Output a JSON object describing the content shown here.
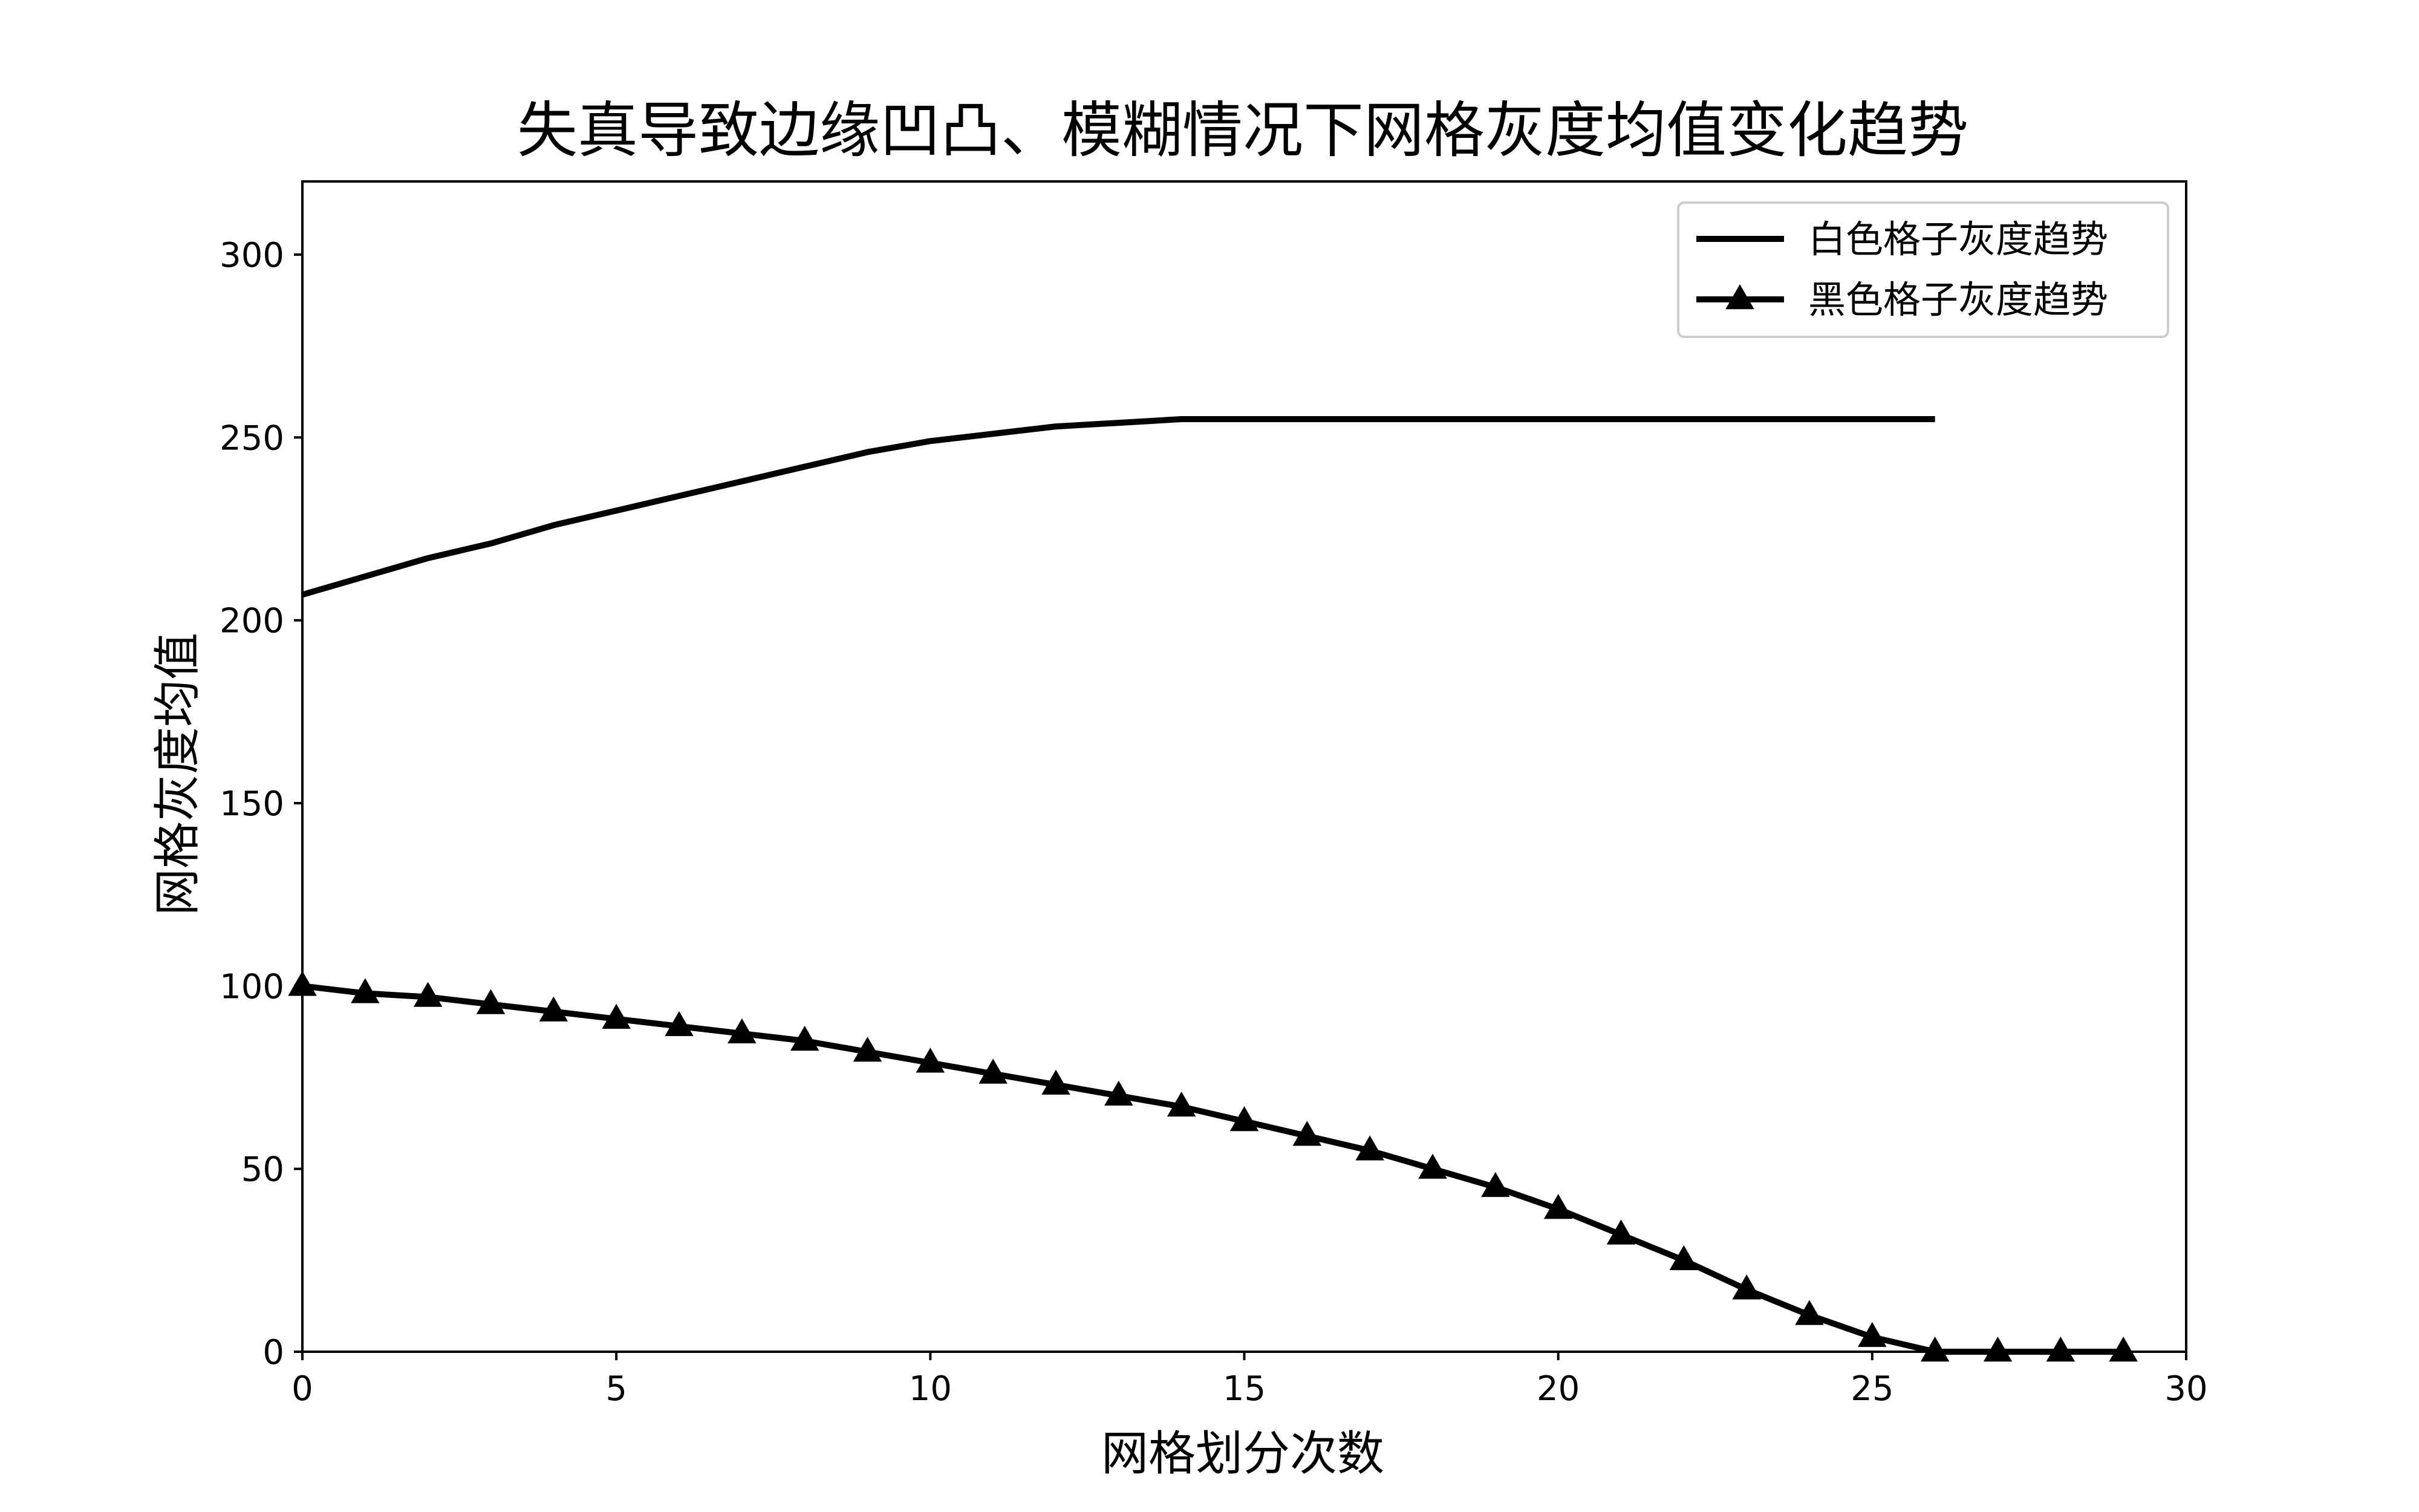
{
  "chart_data": {
    "type": "line",
    "title": "失真导致边缘凹凸、模糊情况下网格灰度均值变化趋势",
    "xlabel": "网格划分次数",
    "ylabel": "网格灰度均值",
    "xlim": [
      0,
      30
    ],
    "ylim": [
      0,
      320
    ],
    "xticks": [
      0,
      5,
      10,
      15,
      20,
      25,
      30
    ],
    "yticks": [
      0,
      50,
      100,
      150,
      200,
      250,
      300
    ],
    "grid": false,
    "legend_position": "top-right",
    "series": [
      {
        "name": "白色格子灰度趋势",
        "color": "#000000",
        "marker": "none",
        "x": [
          0,
          1,
          2,
          3,
          4,
          5,
          6,
          7,
          8,
          9,
          10,
          11,
          12,
          13,
          14,
          15,
          16,
          17,
          18,
          19,
          20,
          21,
          22,
          23,
          24,
          25,
          26
        ],
        "values": [
          207,
          212,
          217,
          221,
          226,
          230,
          234,
          238,
          242,
          246,
          249,
          251,
          253,
          254,
          255,
          255,
          255,
          255,
          255,
          255,
          255,
          255,
          255,
          255,
          255,
          255,
          255
        ]
      },
      {
        "name": "黑色格子灰度趋势",
        "color": "#000000",
        "marker": "triangle",
        "x": [
          0,
          1,
          2,
          3,
          4,
          5,
          6,
          7,
          8,
          9,
          10,
          11,
          12,
          13,
          14,
          15,
          16,
          17,
          18,
          19,
          20,
          21,
          22,
          23,
          24,
          25,
          26,
          27,
          28,
          29
        ],
        "values": [
          100,
          98,
          97,
          95,
          93,
          91,
          89,
          87,
          85,
          82,
          79,
          76,
          73,
          70,
          67,
          63,
          59,
          55,
          50,
          45,
          39,
          32,
          25,
          17,
          10,
          4,
          0,
          0,
          0,
          0
        ]
      }
    ]
  }
}
